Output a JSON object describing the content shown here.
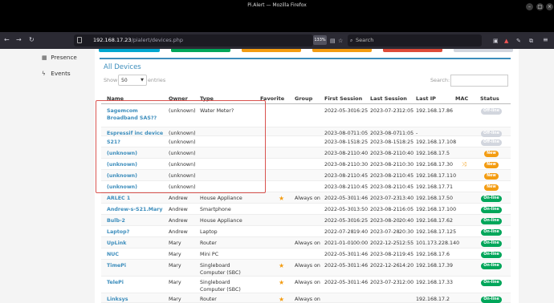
{
  "browser": {
    "window_title": "Pi.Alert — Mozilla Firefox",
    "url_host": "192.168.17.23",
    "url_path": "/pialert/devices.php",
    "zoom": "133%",
    "search_placeholder": "Search"
  },
  "sidebar": {
    "items": [
      {
        "label": "Presence",
        "icon": "calendar-icon"
      },
      {
        "label": "Events",
        "icon": "bolt-icon"
      }
    ]
  },
  "colorbars": [
    "#00a7d0",
    "#00a65a",
    "#f39c12",
    "#f39c12",
    "#dd4b39",
    "#d2d6de"
  ],
  "main": {
    "title": "All Devices",
    "show_label": "Show",
    "page_length": "50",
    "entries_label": "entries",
    "search_label": "Search:"
  },
  "table": {
    "headers": [
      "Name",
      "Owner",
      "Type",
      "Favorite",
      "Group",
      "First Session",
      "Last Session",
      "Last IP",
      "MAC",
      "Status"
    ],
    "rows": [
      {
        "name": "Sagemcom Broadband SAS??",
        "owner": "(unknown)",
        "type": "Water Meter?",
        "favorite": false,
        "group": "",
        "first_date": "2022-05-30",
        "first_time": "16:25",
        "last_date": "2023-07-23",
        "last_time": "12:05",
        "ip": "192.168.17.86",
        "mac": "",
        "status": "Off-line",
        "status_color": "#d2d6de"
      },
      {
        "name": "Espressif inc device",
        "owner": "(unknown)",
        "type": "",
        "favorite": false,
        "group": "",
        "first_date": "2023-08-07",
        "first_time": "11:05",
        "last_date": "2023-08-07",
        "last_time": "11:05",
        "ip": "-",
        "mac": "",
        "status": "Off-line",
        "status_color": "#d2d6de"
      },
      {
        "name": "S21?",
        "owner": "(unknown)",
        "type": "",
        "favorite": false,
        "group": "",
        "first_date": "2023-08-15",
        "first_time": "18:25",
        "last_date": "2023-08-15",
        "last_time": "18:25",
        "ip": "192.168.17.108",
        "mac": "",
        "status": "Off-line",
        "status_color": "#d2d6de"
      },
      {
        "name": "(unknown)",
        "owner": "(unknown)",
        "type": "",
        "favorite": false,
        "group": "",
        "first_date": "2023-08-21",
        "first_time": "10:40",
        "last_date": "2023-08-21",
        "last_time": "10:40",
        "ip": "192.168.17.5",
        "mac": "",
        "status": "New",
        "status_color": "#f39c12"
      },
      {
        "name": "(unknown)",
        "owner": "(unknown)",
        "type": "",
        "favorite": false,
        "group": "",
        "first_date": "2023-08-21",
        "first_time": "10:30",
        "last_date": "2023-08-21",
        "last_time": "10:30",
        "ip": "192.168.17.30",
        "mac": "random",
        "status": "New",
        "status_color": "#f39c12"
      },
      {
        "name": "(unknown)",
        "owner": "(unknown)",
        "type": "",
        "favorite": false,
        "group": "",
        "first_date": "2023-08-21",
        "first_time": "10:45",
        "last_date": "2023-08-21",
        "last_time": "10:45",
        "ip": "192.168.17.110",
        "mac": "",
        "status": "New",
        "status_color": "#f39c12"
      },
      {
        "name": "(unknown)",
        "owner": "(unknown)",
        "type": "",
        "favorite": false,
        "group": "",
        "first_date": "2023-08-21",
        "first_time": "10:45",
        "last_date": "2023-08-21",
        "last_time": "10:45",
        "ip": "192.168.17.71",
        "mac": "",
        "status": "New",
        "status_color": "#f39c12"
      },
      {
        "name": "ARLEC 1",
        "owner": "Andrew",
        "type": "House Appliance",
        "favorite": true,
        "group": "Always on",
        "first_date": "2022-05-30",
        "first_time": "11:46",
        "last_date": "2023-07-23",
        "last_time": "13:40",
        "ip": "192.168.17.50",
        "mac": "",
        "status": "On-line",
        "status_color": "#00a65a"
      },
      {
        "name": "Andrew-s-S21.Mary",
        "owner": "Andrew",
        "type": "Smartphone",
        "favorite": false,
        "group": "",
        "first_date": "2022-05-30",
        "first_time": "13:50",
        "last_date": "2023-08-21",
        "last_time": "16:05",
        "ip": "192.168.17.100",
        "mac": "",
        "status": "On-line",
        "status_color": "#00a65a"
      },
      {
        "name": "Bulb-2",
        "owner": "Andrew",
        "type": "House Appliance",
        "favorite": false,
        "group": "",
        "first_date": "2022-05-30",
        "first_time": "16:25",
        "last_date": "2023-08-20",
        "last_time": "20:40",
        "ip": "192.168.17.62",
        "mac": "",
        "status": "On-line",
        "status_color": "#00a65a"
      },
      {
        "name": "Laptop?",
        "owner": "Andrew",
        "type": "Laptop",
        "favorite": false,
        "group": "",
        "first_date": "2022-07-28",
        "first_time": "19:40",
        "last_date": "2023-07-28",
        "last_time": "20:30",
        "ip": "192.168.17.125",
        "mac": "",
        "status": "On-line",
        "status_color": "#00a65a"
      },
      {
        "name": "UpLink",
        "owner": "Mary",
        "type": "Router",
        "favorite": false,
        "group": "Always on",
        "first_date": "2021-01-01",
        "first_time": "00:00",
        "last_date": "2022-12-25",
        "last_time": "12:55",
        "ip": "101.173.228.140",
        "mac": "",
        "status": "On-line",
        "status_color": "#00a65a"
      },
      {
        "name": "NUC",
        "owner": "Mary",
        "type": "Mini PC",
        "favorite": false,
        "group": "",
        "first_date": "2022-05-30",
        "first_time": "11:46",
        "last_date": "2023-08-21",
        "last_time": "19:45",
        "ip": "192.168.17.6",
        "mac": "",
        "status": "On-line",
        "status_color": "#00a65a"
      },
      {
        "name": "TimePi",
        "owner": "Mary",
        "type": "Singleboard Computer (SBC)",
        "favorite": true,
        "group": "Always on",
        "first_date": "2022-05-30",
        "first_time": "11:46",
        "last_date": "2022-12-26",
        "last_time": "14:20",
        "ip": "192.168.17.39",
        "mac": "",
        "status": "On-line",
        "status_color": "#00a65a"
      },
      {
        "name": "TelePi",
        "owner": "Mary",
        "type": "Singleboard Computer (SBC)",
        "favorite": true,
        "group": "Always on",
        "first_date": "2022-05-30",
        "first_time": "11:46",
        "last_date": "2023-07-23",
        "last_time": "12:00",
        "ip": "192.168.17.33",
        "mac": "",
        "status": "On-line",
        "status_color": "#00a65a"
      },
      {
        "name": "Linksys",
        "owner": "Mary",
        "type": "Router",
        "favorite": true,
        "group": "Always on",
        "first_date": "",
        "first_time": "",
        "last_date": "",
        "last_time": "",
        "ip": "192.168.17.2",
        "mac": "",
        "status": "On-line",
        "status_color": "#00a65a"
      }
    ]
  }
}
